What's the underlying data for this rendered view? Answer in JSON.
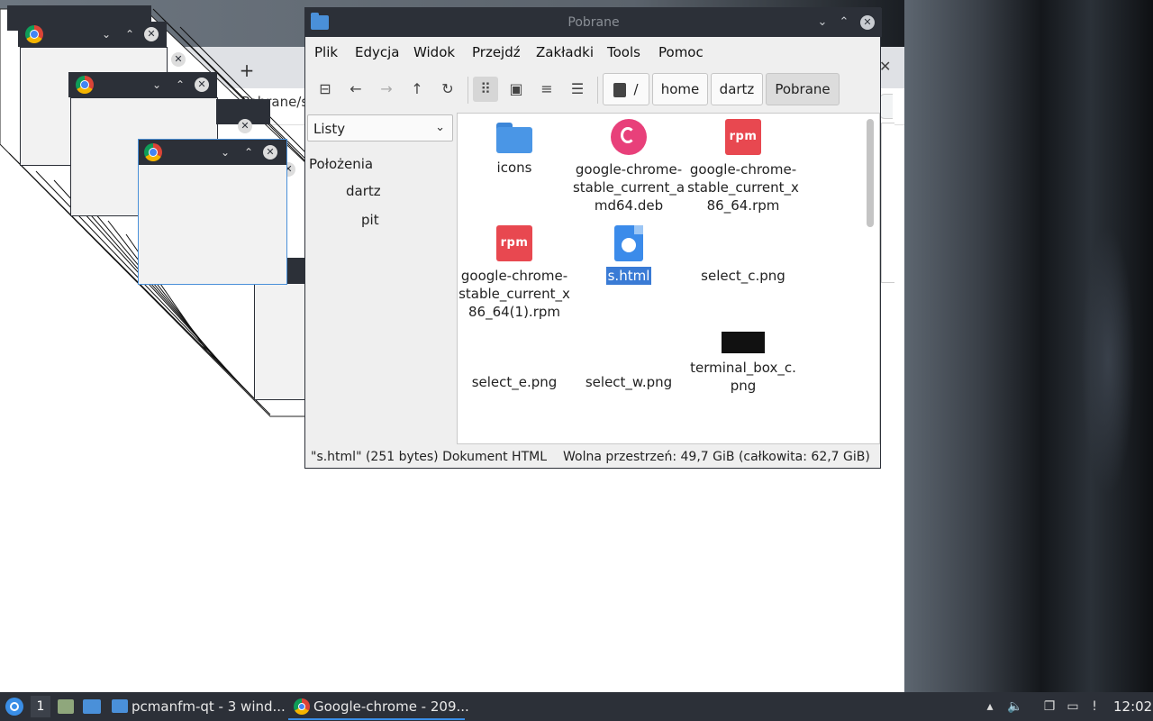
{
  "chrome_window": {
    "url_fragment": "Pobrane/s",
    "new_tab_label": "+"
  },
  "file_manager": {
    "title": "Pobrane",
    "menu": [
      "Plik",
      "Edycja",
      "Widok",
      "Przejdź",
      "Zakładki",
      "Tools",
      "Pomoc"
    ],
    "breadcrumbs": {
      "root": "/",
      "home": "home",
      "user": "dartz",
      "current": "Pobrane"
    },
    "sidebar": {
      "mode": "Listy",
      "section_label": "Położenia",
      "items": [
        "dartz",
        "pit"
      ]
    },
    "files": [
      {
        "name_lines": [
          "icons"
        ],
        "icon": "folder-icon"
      },
      {
        "name_lines": [
          "google-chrome-",
          "stable_current_a",
          "md64.deb"
        ],
        "icon": "debian-package-icon"
      },
      {
        "name_lines": [
          "google-chrome-",
          "stable_current_x",
          "86_64.rpm"
        ],
        "icon": "rpm-package-icon",
        "icon_text": "rpm"
      },
      {
        "name_lines": [
          "google-chrome-",
          "stable_current_x",
          "86_64(1).rpm"
        ],
        "icon": "rpm-package-icon",
        "icon_text": "rpm"
      },
      {
        "name_lines": [
          "s.html"
        ],
        "icon": "html-file-icon",
        "selected": true
      },
      {
        "name_lines": [
          "select_c.png"
        ],
        "icon": "image-file-icon"
      },
      {
        "name_lines": [
          "select_e.png"
        ],
        "icon": "image-file-icon"
      },
      {
        "name_lines": [
          "select_w.png"
        ],
        "icon": "image-file-icon"
      },
      {
        "name_lines": [
          "terminal_box_c.",
          "png"
        ],
        "icon": "image-thumbnail-icon"
      }
    ],
    "status": {
      "left": "\"s.html\" (251 bytes) Dokument HTML",
      "right": "Wolna przestrzeń: 49,7 GiB (całkowita: 62,7 GiB)"
    }
  },
  "taskbar": {
    "workspace": "1",
    "tasks": [
      {
        "label": "pcmanfm-qt - 3 wind...",
        "icon": "folder-icon"
      },
      {
        "label": "Google-chrome - 209...",
        "icon": "chrome-icon",
        "active": true
      }
    ],
    "clock": "12:02"
  },
  "colors": {
    "titlebar": "#2c3038",
    "selection": "#3a7bd5",
    "taskbar": "#2c3038"
  }
}
